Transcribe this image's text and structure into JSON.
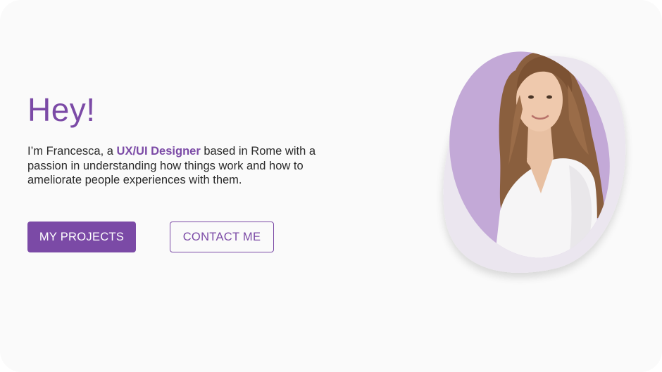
{
  "hero": {
    "title": "Hey!",
    "intro_prefix": "I’m Francesca, a ",
    "intro_highlight": "UX/UI Designer",
    "intro_suffix": " based in Rome with a passion in understanding how things work and how to ameliorate people experiences with them."
  },
  "actions": {
    "primary_label": "MY PROJECTS",
    "secondary_label": "CONTACT ME"
  },
  "colors": {
    "accent": "#7b4aa6",
    "blob_main": "#c3a9d7",
    "blob_back": "#ebe6ef",
    "background": "#fafafa"
  },
  "portrait": {
    "description_icon": "profile-photo"
  }
}
